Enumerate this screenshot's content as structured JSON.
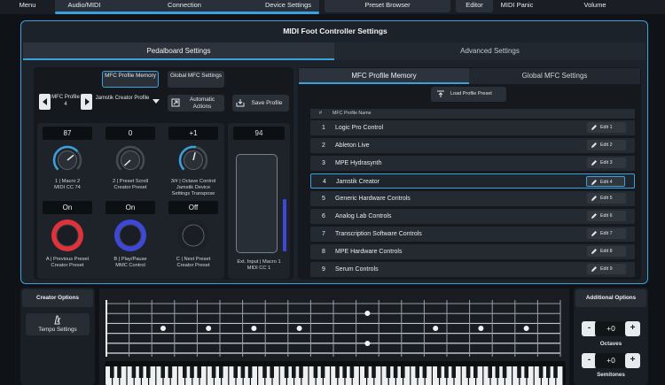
{
  "topbar": {
    "menu": "Menu",
    "audio_midi": "Audio/MIDI",
    "connection": "Connection",
    "device_settings": "Device Settings",
    "preset_browser": "Preset Browser",
    "editor": "Editor",
    "midi_panic": "MIDI Panic",
    "volume": "Volume"
  },
  "panel": {
    "title": "MIDI Foot Controller Settings",
    "tab_pedalboard": "Pedalboard Settings",
    "tab_advanced": "Advanced Settings"
  },
  "pedalboard": {
    "mfc_profile_memory_btn": "MFC Profile Memory",
    "global_mfc_settings_btn": "Global MFC Settings",
    "profile_name": "MFC Profile 4",
    "creator_profile": "Jamstik Creator Profile",
    "automatic_actions": "Automatic Actions",
    "save_profile": "Save Profile",
    "knobs": [
      {
        "value": "87",
        "label": "1 | Macro 2\nMIDI CC 74",
        "level": 0.69
      },
      {
        "value": "0",
        "label": "2 | Preset Scroll\nCreator Preset",
        "level": 0.0
      },
      {
        "value": "+1",
        "label": "3/# | Octave Control\nJamstik Device\nSettings Transpose",
        "level": 0.55
      }
    ],
    "switches": [
      {
        "state": "On",
        "label": "A | Previous Preset\nCreator Preset",
        "color": "#e0323a"
      },
      {
        "state": "On",
        "label": "B | Play/Pause\nMMC Control",
        "color": "#3d48d6"
      },
      {
        "state": "Off",
        "label": "C | Next Preset\nCreator Preset",
        "color": "#1a1e24"
      }
    ],
    "expression": {
      "value": "94",
      "label": "Ext. Input | Macro 1\nMIDI CC 1",
      "level": 0.74
    }
  },
  "memory": {
    "tab_mfc_profile_memory": "MFC Profile Memory",
    "tab_global_mfc_settings": "Global MFC Settings",
    "load_profile_preset": "Load Profile Preset",
    "col_num": "#",
    "col_name": "MFC Profile Name",
    "rows": [
      {
        "num": "1",
        "name": "Logic Pro Control",
        "edit": "Edit 1"
      },
      {
        "num": "2",
        "name": "Ableton Live",
        "edit": "Edit 2"
      },
      {
        "num": "3",
        "name": "MPE Hydrasynth",
        "edit": "Edit 3"
      },
      {
        "num": "4",
        "name": "Jamstik Creator",
        "edit": "Edit 4"
      },
      {
        "num": "5",
        "name": "Generic Hardware Controls",
        "edit": "Edit 5"
      },
      {
        "num": "6",
        "name": "Analog Lab Controls",
        "edit": "Edit 6"
      },
      {
        "num": "7",
        "name": "Transcription Software Controls",
        "edit": "Edit 7"
      },
      {
        "num": "8",
        "name": "MPE Hardware Controls",
        "edit": "Edit 8"
      },
      {
        "num": "9",
        "name": "Serum Controls",
        "edit": "Edit 9"
      }
    ],
    "selected_index": 3
  },
  "creator_options": {
    "title": "Creator Options",
    "tempo_settings": "Tempo Settings"
  },
  "additional_options": {
    "title": "Additional Options",
    "octaves_value": "+0",
    "octaves_label": "Octaves",
    "semitones_value": "+0",
    "semitones_label": "Semitones",
    "minus": "-",
    "plus": "+"
  },
  "colors": {
    "accent": "#3aa1dd"
  }
}
